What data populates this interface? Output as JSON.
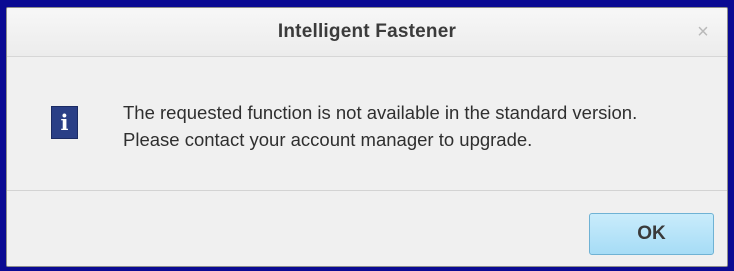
{
  "dialog": {
    "title": "Intelligent Fastener",
    "close_glyph": "×",
    "icon": "info-icon",
    "icon_glyph": "i",
    "message_line1": "The requested function is not available in the standard version.",
    "message_line2": "Please contact your account manager to upgrade.",
    "ok_label": "OK"
  },
  "colors": {
    "outer_background": "#0a0a93",
    "dialog_background": "#f0f0f0",
    "info_icon": "#2a3f86",
    "ok_button": "#a6dcf6"
  }
}
